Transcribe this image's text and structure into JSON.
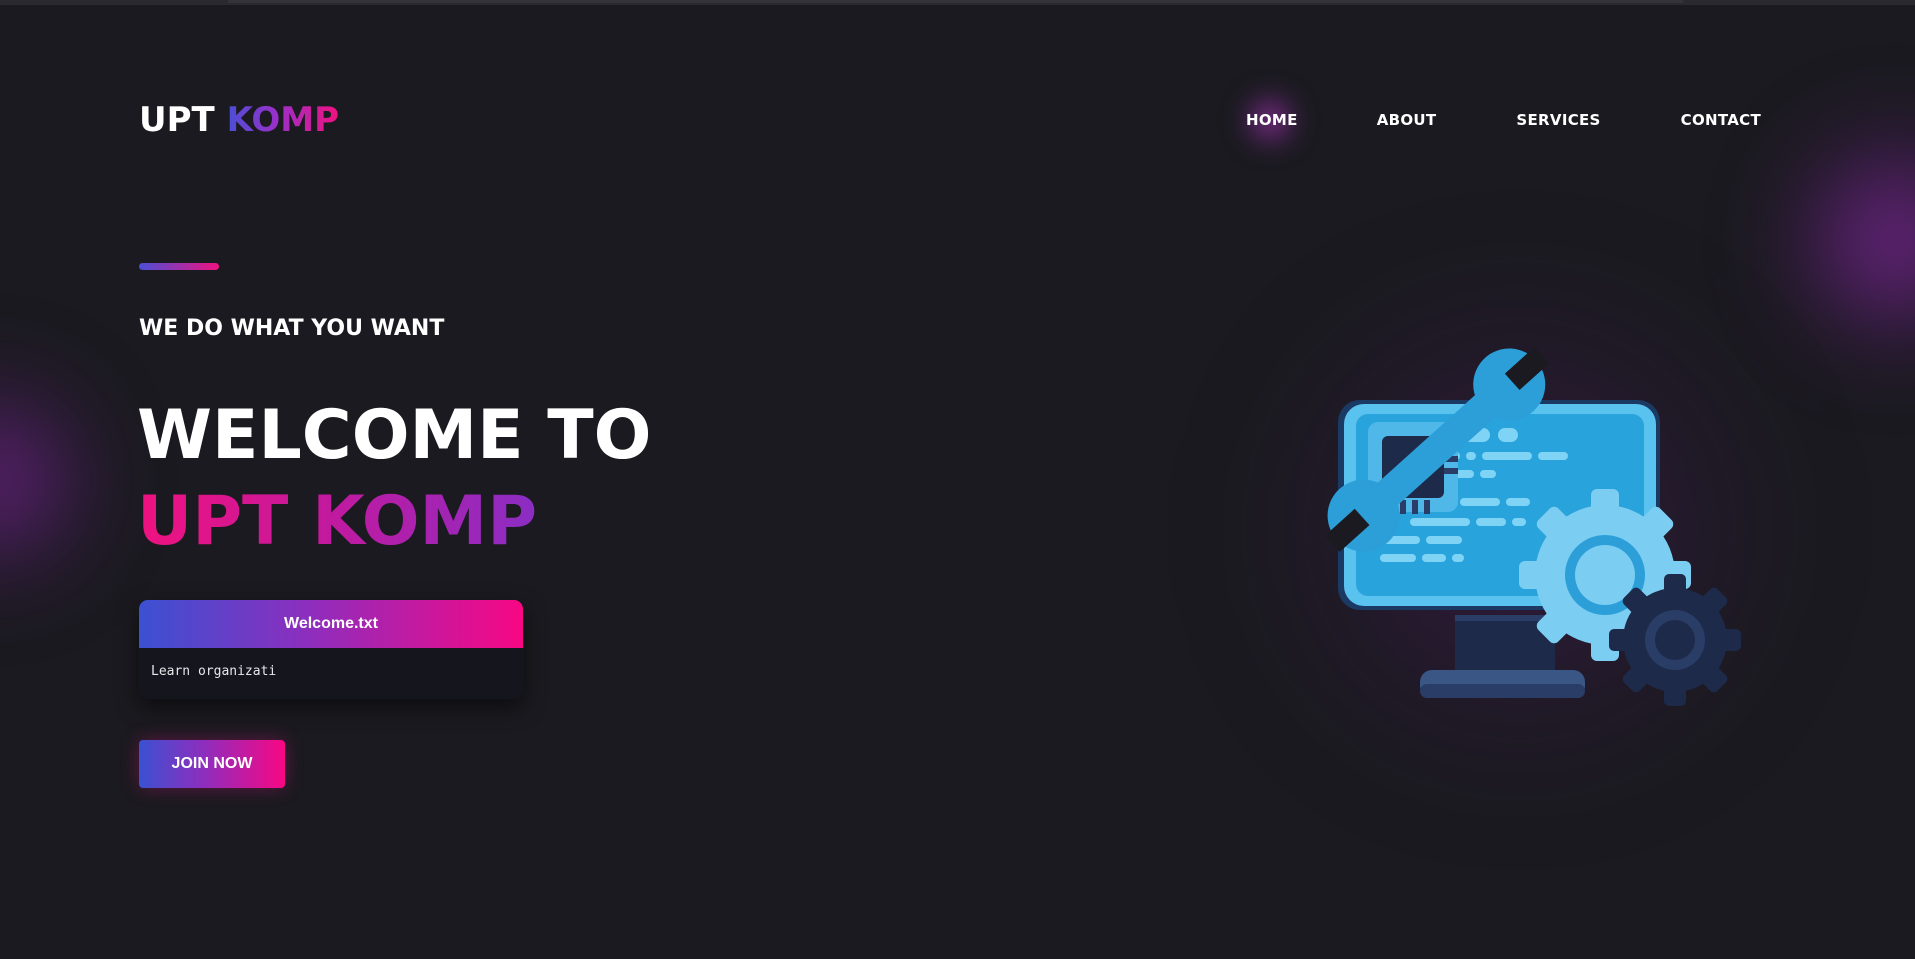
{
  "header": {
    "logo_part1": "UPT ",
    "logo_part2": "KOMP",
    "nav": [
      {
        "label": "HOME"
      },
      {
        "label": "ABOUT"
      },
      {
        "label": "SERVICES"
      },
      {
        "label": "CONTACT"
      }
    ]
  },
  "hero": {
    "tagline": "WE DO WHAT YOU WANT",
    "headline_line1": "WELCOME TO",
    "headline_line2": "UPT KOMP",
    "terminal": {
      "title": "Welcome.txt",
      "text": "Learn organizati"
    },
    "cta_label": "JOIN NOW"
  },
  "illustration": {
    "icon": "computer-repair-illustration"
  },
  "colors": {
    "background": "#1b1a20",
    "gradient_start": "#3b51d2",
    "gradient_mid": "#8f2dbd",
    "gradient_end": "#f80783",
    "illustration_blue": "#29a3dc",
    "illustration_dark": "#1d2a4a"
  }
}
